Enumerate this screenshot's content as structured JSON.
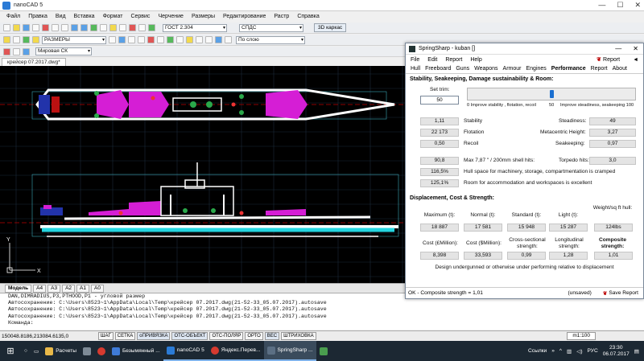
{
  "cad": {
    "title": "nanoCAD 5",
    "menu": [
      "Файл",
      "Правка",
      "Вид",
      "Вставка",
      "Формат",
      "Сервис",
      "Черчение",
      "Размеры",
      "Редактирование",
      "Растр",
      "Справка"
    ],
    "style_combo": "ГОСТ 2.304",
    "spds_combo": "СПДС",
    "btn_3d": "3D каркас",
    "layer_combo": "РАЗМЕРЫ",
    "linetype_combo": "По слою",
    "lineweight_combo": "По слою",
    "color_combo": "По слою",
    "ucs_combo": "Мировая СК",
    "doc_tab": "крейсер 07.2017.dwg*",
    "layout_tabs": [
      "Модель",
      "A4",
      "A3",
      "A2",
      "A1",
      "A0"
    ],
    "console_lines": [
      "DAN,DIMRADIUS,P3,PTHOOD,P1 - угловой размер",
      "Автосохранение: C:\\Users\\8523~1\\AppData\\Local\\Temp\\крейсер 07.2017.dwg(21-52-33_05.07.2017).autosave",
      "Автосохранение: C:\\Users\\8523~1\\AppData\\Local\\Temp\\крейсер 07.2017.dwg(21-52-33_05.07.2017).autosave",
      "Автосохранение: C:\\Users\\8523~1\\AppData\\Local\\Temp\\крейсер 07.2017.dwg(21-52-33_05.07.2017).autosave",
      "Команда:"
    ],
    "console_side": "Коман",
    "coords": "150048.8186,213084.6135,0",
    "status_toggles": [
      "ШАГ",
      "СЕТКА",
      "оПРИВЯЗКА",
      "ОТС-ОБЪЕКТ",
      "ОТС-ПОЛЯР",
      "ОРТО",
      "ВЕС",
      "ШТРИХОВКА"
    ],
    "scale": "m1:100"
  },
  "springsharp": {
    "title": "SpringSharp - kuban []",
    "menu": [
      "File",
      "Edit",
      "Report",
      "Help"
    ],
    "report_btn": "Report",
    "tabs": [
      "Hull",
      "Freeboard",
      "Guns",
      "Weapons",
      "Armour",
      "Engines",
      "Performance",
      "Report",
      "About"
    ],
    "active_tab": "Performance",
    "section1": "Stability, Seakeeping, Damage sustainability & Room:",
    "set_trim_label": "Set trim:",
    "set_trim_value": "50",
    "trim_fraction": 0.5,
    "trim_left": "0 Improve stability , flotation, recoil",
    "trim_mid": "50",
    "trim_right": "Improve steadiness, seakeeping 100",
    "stability": "1,11",
    "stability_label": "Stability",
    "flotation": "22 173",
    "flotation_label": "Flotation",
    "recoil": "0,50",
    "recoil_label": "Recoil",
    "steadiness_label": "Steadiness:",
    "steadiness": "49",
    "metacentric_label": "Metacentric Height:",
    "metacentric": "3,27",
    "seakeeping_label": "Seakeeping:",
    "seakeeping": "0,97",
    "shell_hits_val": "90,8",
    "shell_hits_label": "Max 7,87 \" / 200mm shell hits:",
    "torpedo_label": "Torpedo hits:",
    "torpedo_val": "3,0",
    "hull_space_val": "116,5%",
    "hull_space_label": "Hull space for machinery, storage, compartmentation is cramped",
    "room_val": "125,1%",
    "room_label": "Room for accommodation and workspaces is excellent",
    "section2": "Displacement, Cost & Strength:",
    "disp_headers": [
      "Maximum (t):",
      "Normal (t):",
      "Standard (t):",
      "Light (t):",
      "Weight/sq ft hull:"
    ],
    "disp_values": [
      "18 887",
      "17 581",
      "15 948",
      "15 287",
      "124lbs"
    ],
    "cost_headers": [
      "Cost (£Million):",
      "Cost ($Million):",
      "Cross-sectional strength:",
      "Longitudinal strength:",
      "Composite strength:"
    ],
    "cost_values": [
      "8,398",
      "33,593",
      "0,99",
      "1,28",
      "1,01"
    ],
    "design_note": "Design undergunned or otherwise under performing relative to displacement",
    "footer_status": "OK - Composite strength = 1,01",
    "unsaved": "(unsaved)",
    "save_report": "Save Report"
  },
  "taskbar": {
    "items": [
      {
        "label": "Расчеты",
        "color": "#e9b949"
      },
      {
        "label": "",
        "color": "#7d8a96"
      },
      {
        "label": "",
        "color": "#d63a2f"
      },
      {
        "label": "Безымянный ...",
        "color": "#3f7bd8"
      },
      {
        "label": "nanoCAD 5",
        "color": "#2b7bd6"
      },
      {
        "label": "Яндекс.Перев...",
        "color": "#d63a2f"
      },
      {
        "label": "SpringSharp ...",
        "color": "#5b6f84"
      }
    ],
    "links": "Ссылки",
    "lang": "РУС",
    "time": "23:30",
    "date": "06.07.2017"
  }
}
